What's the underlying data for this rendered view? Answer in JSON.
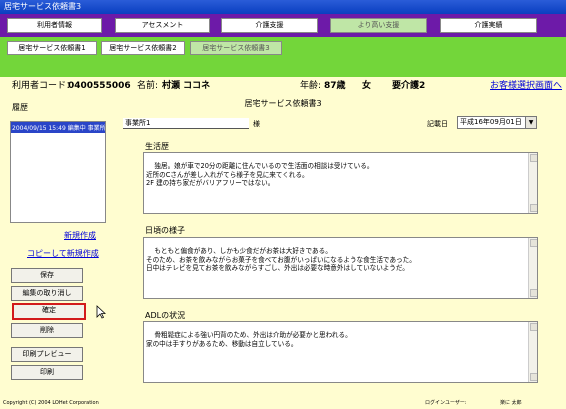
{
  "window": {
    "title": "居宅サービス依頼書3"
  },
  "nav_tabs": [
    {
      "label": "利用者情報"
    },
    {
      "label": "アセスメント"
    },
    {
      "label": "介護支援"
    },
    {
      "label": "より高い支援"
    },
    {
      "label": "介護実績"
    }
  ],
  "sub_tabs": [
    {
      "label": "居宅サービス依頼書1"
    },
    {
      "label": "居宅サービス依頼書2"
    },
    {
      "label": "居宅サービス依頼書3"
    }
  ],
  "user": {
    "code_label": "利用者コード：",
    "code": "0400555006",
    "name_label": "名前:",
    "name": "村瀬 ココネ",
    "age_label": "年齢:",
    "age": "87歳",
    "gender": "女",
    "care_level": "要介護2",
    "customer_select_link": "お客様選択画面へ"
  },
  "history": {
    "label": "履歴",
    "selected_item": "2004/09/15 15:49 編集中 事業所"
  },
  "side_links": {
    "new": "新規作成",
    "copy_new": "コピーして新規作成"
  },
  "buttons": {
    "save": "保存",
    "cancel_edit": "編集の取り消し",
    "confirm": "確定",
    "delete": "削除",
    "print_preview": "印刷プレビュー",
    "print": "印刷"
  },
  "document": {
    "title": "居宅サービス依頼書3",
    "office": "事業所1",
    "honorific": "様",
    "date_label": "記載日",
    "date_value": "平成16年09月01日"
  },
  "sections": {
    "life_history": {
      "label": "生活歴",
      "text": "独居。娘が車で20分の距離に住んでいるので生活面の相談は受けている。\n近所のCさんが差し入れがてら様子を見に来てくれる。\n2F 建の持ち家だがバリアフリーではない。"
    },
    "daily_life": {
      "label": "日頃の様子",
      "text": "もともと偏食があり、しかも少食だがお茶は大好きである。\nそのため、お茶を飲みながらお菓子を食べてお腹がいっぱいになるような食生活であった。\n日中はテレビを見てお茶を飲みながらすごし、外出は必要な時意外はしていないようだ。"
    },
    "adl": {
      "label": "ADLの状況",
      "text": "骨粗鬆症による強い円背のため、外出は介助が必要かと思われる。\n家の中は手すりがあるため、移動は自立している。"
    }
  },
  "footer": {
    "copyright": "Copyright (C) 2004 LOHet Corporation",
    "login_label": "ログインユーザー:",
    "login_user": "楽に 太郎"
  }
}
